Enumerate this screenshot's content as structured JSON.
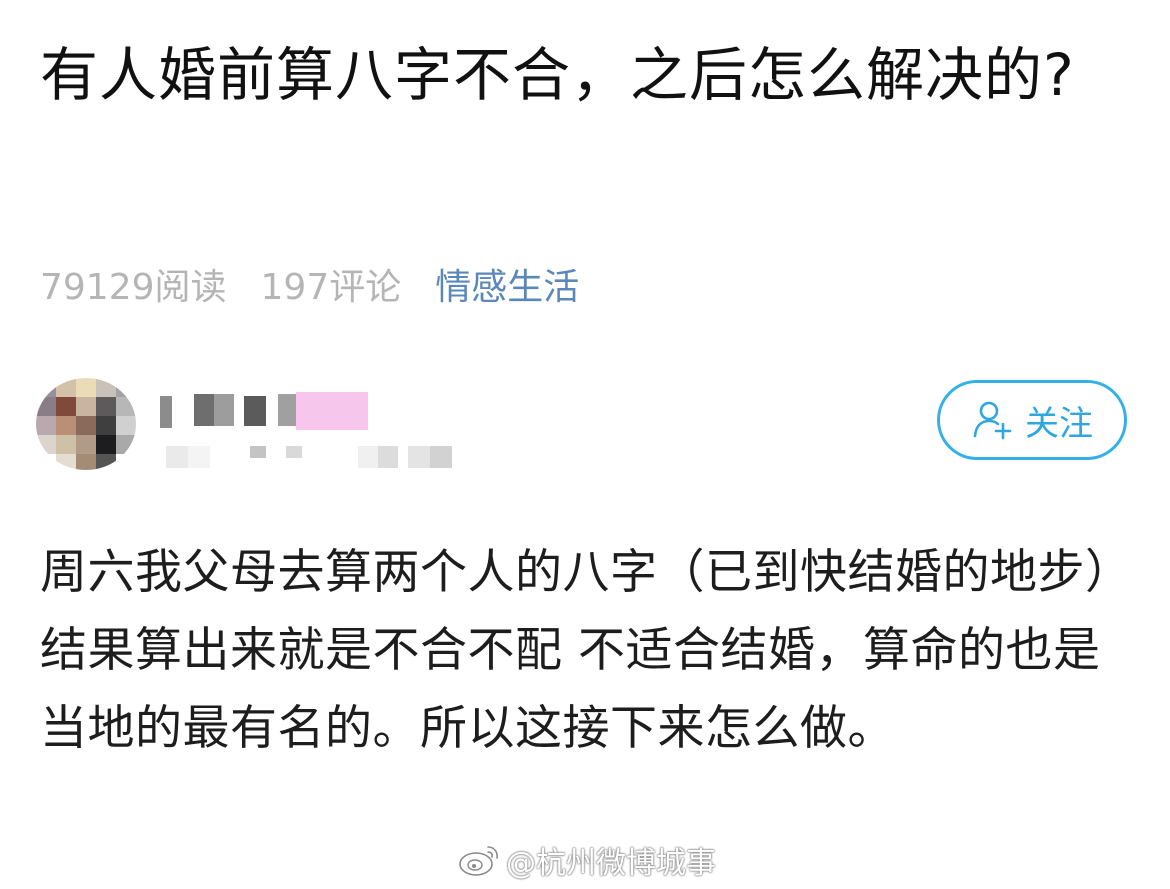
{
  "post": {
    "title": "有人婚前算八字不合，之后怎么解决的?",
    "stats": {
      "reads": "79129阅读",
      "comments": "197评论",
      "topic": "情感生活"
    },
    "author": {
      "name": "",
      "follow_label": "关注",
      "follow_icon": "add-user-icon",
      "avatar_colors": [
        "#9a8e9c",
        "#d4c1a9",
        "#e9dcb6",
        "#c9c2bb",
        "#a3a3a3",
        "#8a7d88",
        "#7f4a3c",
        "#c9b4a0",
        "#5d5a5b",
        "#b7b7b7",
        "#b9a8ae",
        "#ba8f78",
        "#8a6a5a",
        "#3f3f40",
        "#d0d0d0",
        "#dcd4cf",
        "#cfc0a8",
        "#b29b86",
        "#1d1d1f",
        "#a9a9a9",
        "#ffffff",
        "#e5ddd2",
        "#a48b74",
        "#555555",
        "#ffffff"
      ]
    },
    "body": "周六我父母去算两个人的八字（已到快结婚的地步）结果算出来就是不合不配 不适合结婚，算命的也是当地的最有名的。所以这接下来怎么做。"
  },
  "watermark": {
    "icon": "weibo-icon",
    "text": "@杭州微博城事"
  },
  "colors": {
    "title": "#111111",
    "meta": "#b5b5b5",
    "topic": "#5b88b8",
    "follow_border": "#33b1e6",
    "body": "#1d1d1d"
  }
}
